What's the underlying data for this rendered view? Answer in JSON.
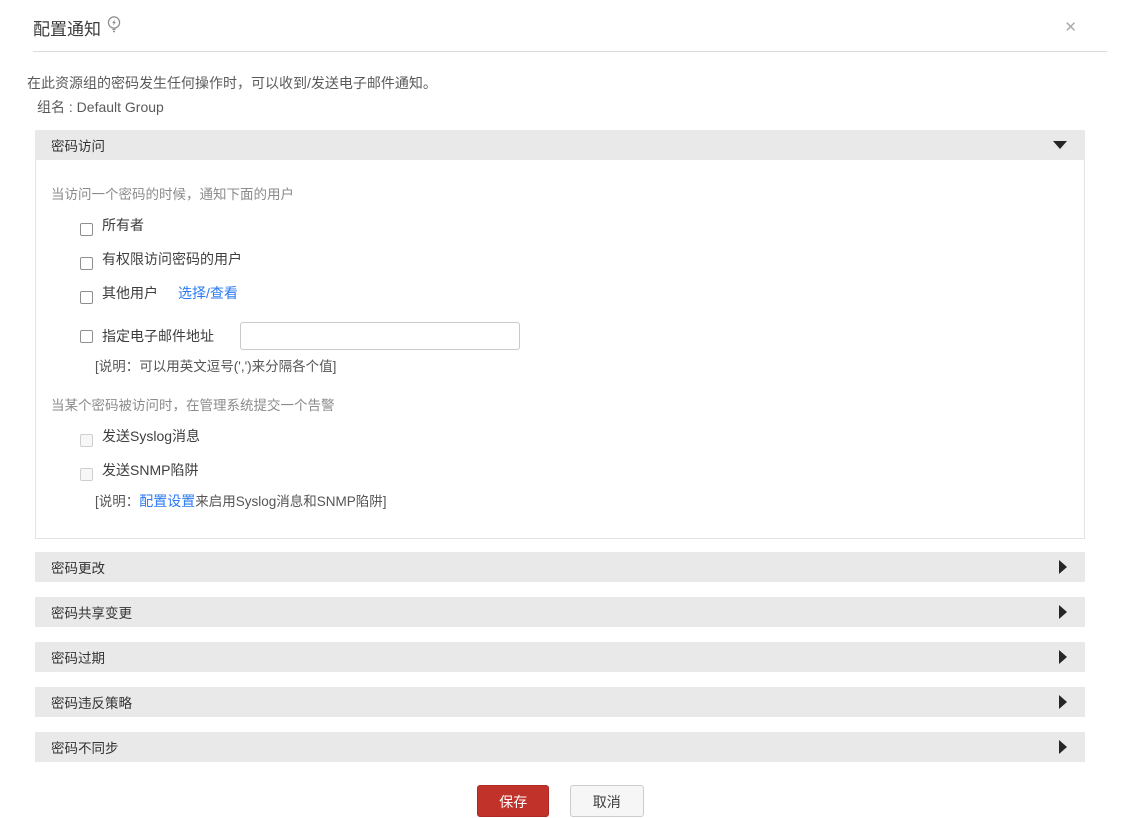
{
  "dialog": {
    "title": "配置通知",
    "close_glyph": "✕"
  },
  "intro": {
    "description": "在此资源组的密码发生任何操作时，可以收到/发送电子邮件通知。",
    "group_name": "组名 : Default Group"
  },
  "access": {
    "header": "密码访问",
    "notify_lead": "当访问一个密码的时候，通知下面的用户",
    "options": [
      {
        "label": "所有者",
        "checked": false
      },
      {
        "label": "有权限访问密码的用户",
        "checked": false
      },
      {
        "label": "其他用户",
        "checked": false
      }
    ],
    "select_view_link": "选择/查看",
    "email_option_label": "指定电子邮件地址",
    "email_value": "",
    "email_note": "[说明：可以用英文逗号(',')来分隔各个值]",
    "alert_lead": "当某个密码被访问时，在管理系统提交一个告警",
    "syslog_label": "发送Syslog消息",
    "snmp_label": "发送SNMP陷阱",
    "config_note_prefix": "[说明：",
    "config_note_link": "配置设置",
    "config_note_suffix": "来启用Syslog消息和SNMP陷阱]"
  },
  "collapsed": [
    {
      "header": "密码更改"
    },
    {
      "header": "密码共享变更"
    },
    {
      "header": "密码过期"
    },
    {
      "header": "密码违反策略"
    },
    {
      "header": "密码不同步"
    }
  ],
  "footer": {
    "save": "保存",
    "cancel": "取消"
  },
  "colors": {
    "accent_red": "#c1322a",
    "link_blue": "#2b7af3",
    "section_header_bg": "#e9e9e9"
  }
}
